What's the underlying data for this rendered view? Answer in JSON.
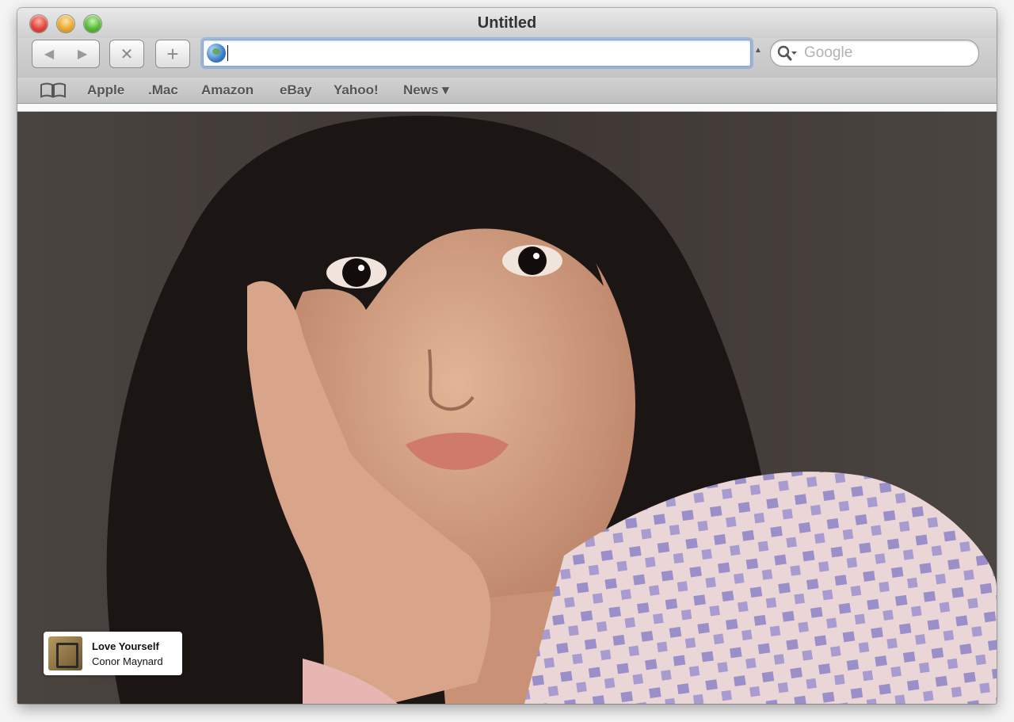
{
  "window": {
    "title": "Untitled"
  },
  "toolbar": {
    "back_icon": "back-arrow-icon",
    "forward_icon": "forward-arrow-icon",
    "stop_label": "✕",
    "add_label": "+",
    "address_value": "",
    "search_placeholder": "Google"
  },
  "bookmarks": {
    "icon": "book-icon",
    "items": [
      {
        "label": "Apple"
      },
      {
        "label": ".Mac"
      },
      {
        "label": "Amazon"
      },
      {
        "label": "eBay"
      },
      {
        "label": "Yahoo!"
      },
      {
        "label": "News ▾"
      }
    ]
  },
  "now_playing": {
    "song": "Love Yourself",
    "artist": "Conor Maynard"
  },
  "colors": {
    "address_focus": "#7ea4d6"
  }
}
